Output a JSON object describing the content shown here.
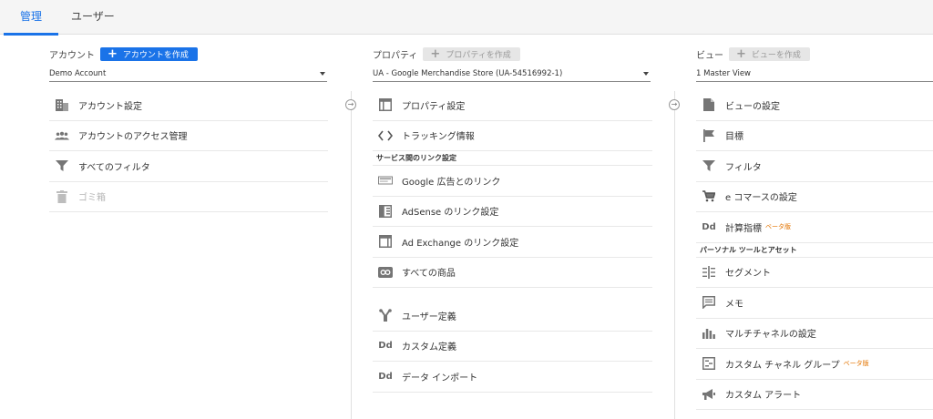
{
  "tabs": [
    {
      "label": "管理",
      "active": true
    },
    {
      "label": "ユーザー",
      "active": false
    }
  ],
  "account": {
    "label": "アカウント",
    "create_button": "アカウントを作成",
    "selected": "Demo Account",
    "items": [
      {
        "label": "アカウント設定",
        "icon": "building-icon"
      },
      {
        "label": "アカウントのアクセス管理",
        "icon": "people-icon"
      },
      {
        "label": "すべてのフィルタ",
        "icon": "filter-icon"
      },
      {
        "label": "ゴミ箱",
        "icon": "trash-icon",
        "disabled": true
      }
    ]
  },
  "property": {
    "label": "プロパティ",
    "create_button": "プロパティを作成",
    "selected": "UA - Google Merchandise Store (UA-54516992-1)",
    "items": [
      {
        "label": "プロパティ設定",
        "icon": "window-icon"
      },
      {
        "label": "トラッキング情報",
        "icon": "code-icon"
      }
    ],
    "section_label": "サービス間のリンク設定",
    "link_items": [
      {
        "label": "Google 広告とのリンク",
        "icon": "ads-icon"
      },
      {
        "label": "AdSense のリンク設定",
        "icon": "adsense-icon"
      },
      {
        "label": "Ad Exchange のリンク設定",
        "icon": "adexchange-icon"
      },
      {
        "label": "すべての商品",
        "icon": "link-icon"
      }
    ],
    "more_items": [
      {
        "label": "ユーザー定義",
        "icon": "fork-icon"
      },
      {
        "label": "カスタム定義",
        "icon": "dd-icon"
      },
      {
        "label": "データ インポート",
        "icon": "dd-icon"
      }
    ],
    "dd_text": "Dd"
  },
  "view": {
    "label": "ビュー",
    "create_button": "ビューを作成",
    "selected": "1 Master View",
    "items": [
      {
        "label": "ビューの設定",
        "icon": "document-icon"
      },
      {
        "label": "目標",
        "icon": "flag-icon"
      },
      {
        "label": "フィルタ",
        "icon": "filter-icon"
      },
      {
        "label": "e コマースの設定",
        "icon": "cart-icon"
      },
      {
        "label": "計算指標",
        "icon": "dd-icon",
        "beta": "ベータ版"
      }
    ],
    "section_label": "パーソナル ツールとアセット",
    "personal_items": [
      {
        "label": "セグメント",
        "icon": "segment-icon"
      },
      {
        "label": "メモ",
        "icon": "comment-icon"
      },
      {
        "label": "マルチチャネルの設定",
        "icon": "barchart-icon"
      },
      {
        "label": "カスタム チャネル グループ",
        "icon": "group-icon",
        "beta": "ベータ版"
      },
      {
        "label": "カスタム アラート",
        "icon": "megaphone-icon"
      }
    ],
    "dd_text": "Dd"
  },
  "colors": {
    "accent": "#1a73e8",
    "beta": "#e37400"
  }
}
